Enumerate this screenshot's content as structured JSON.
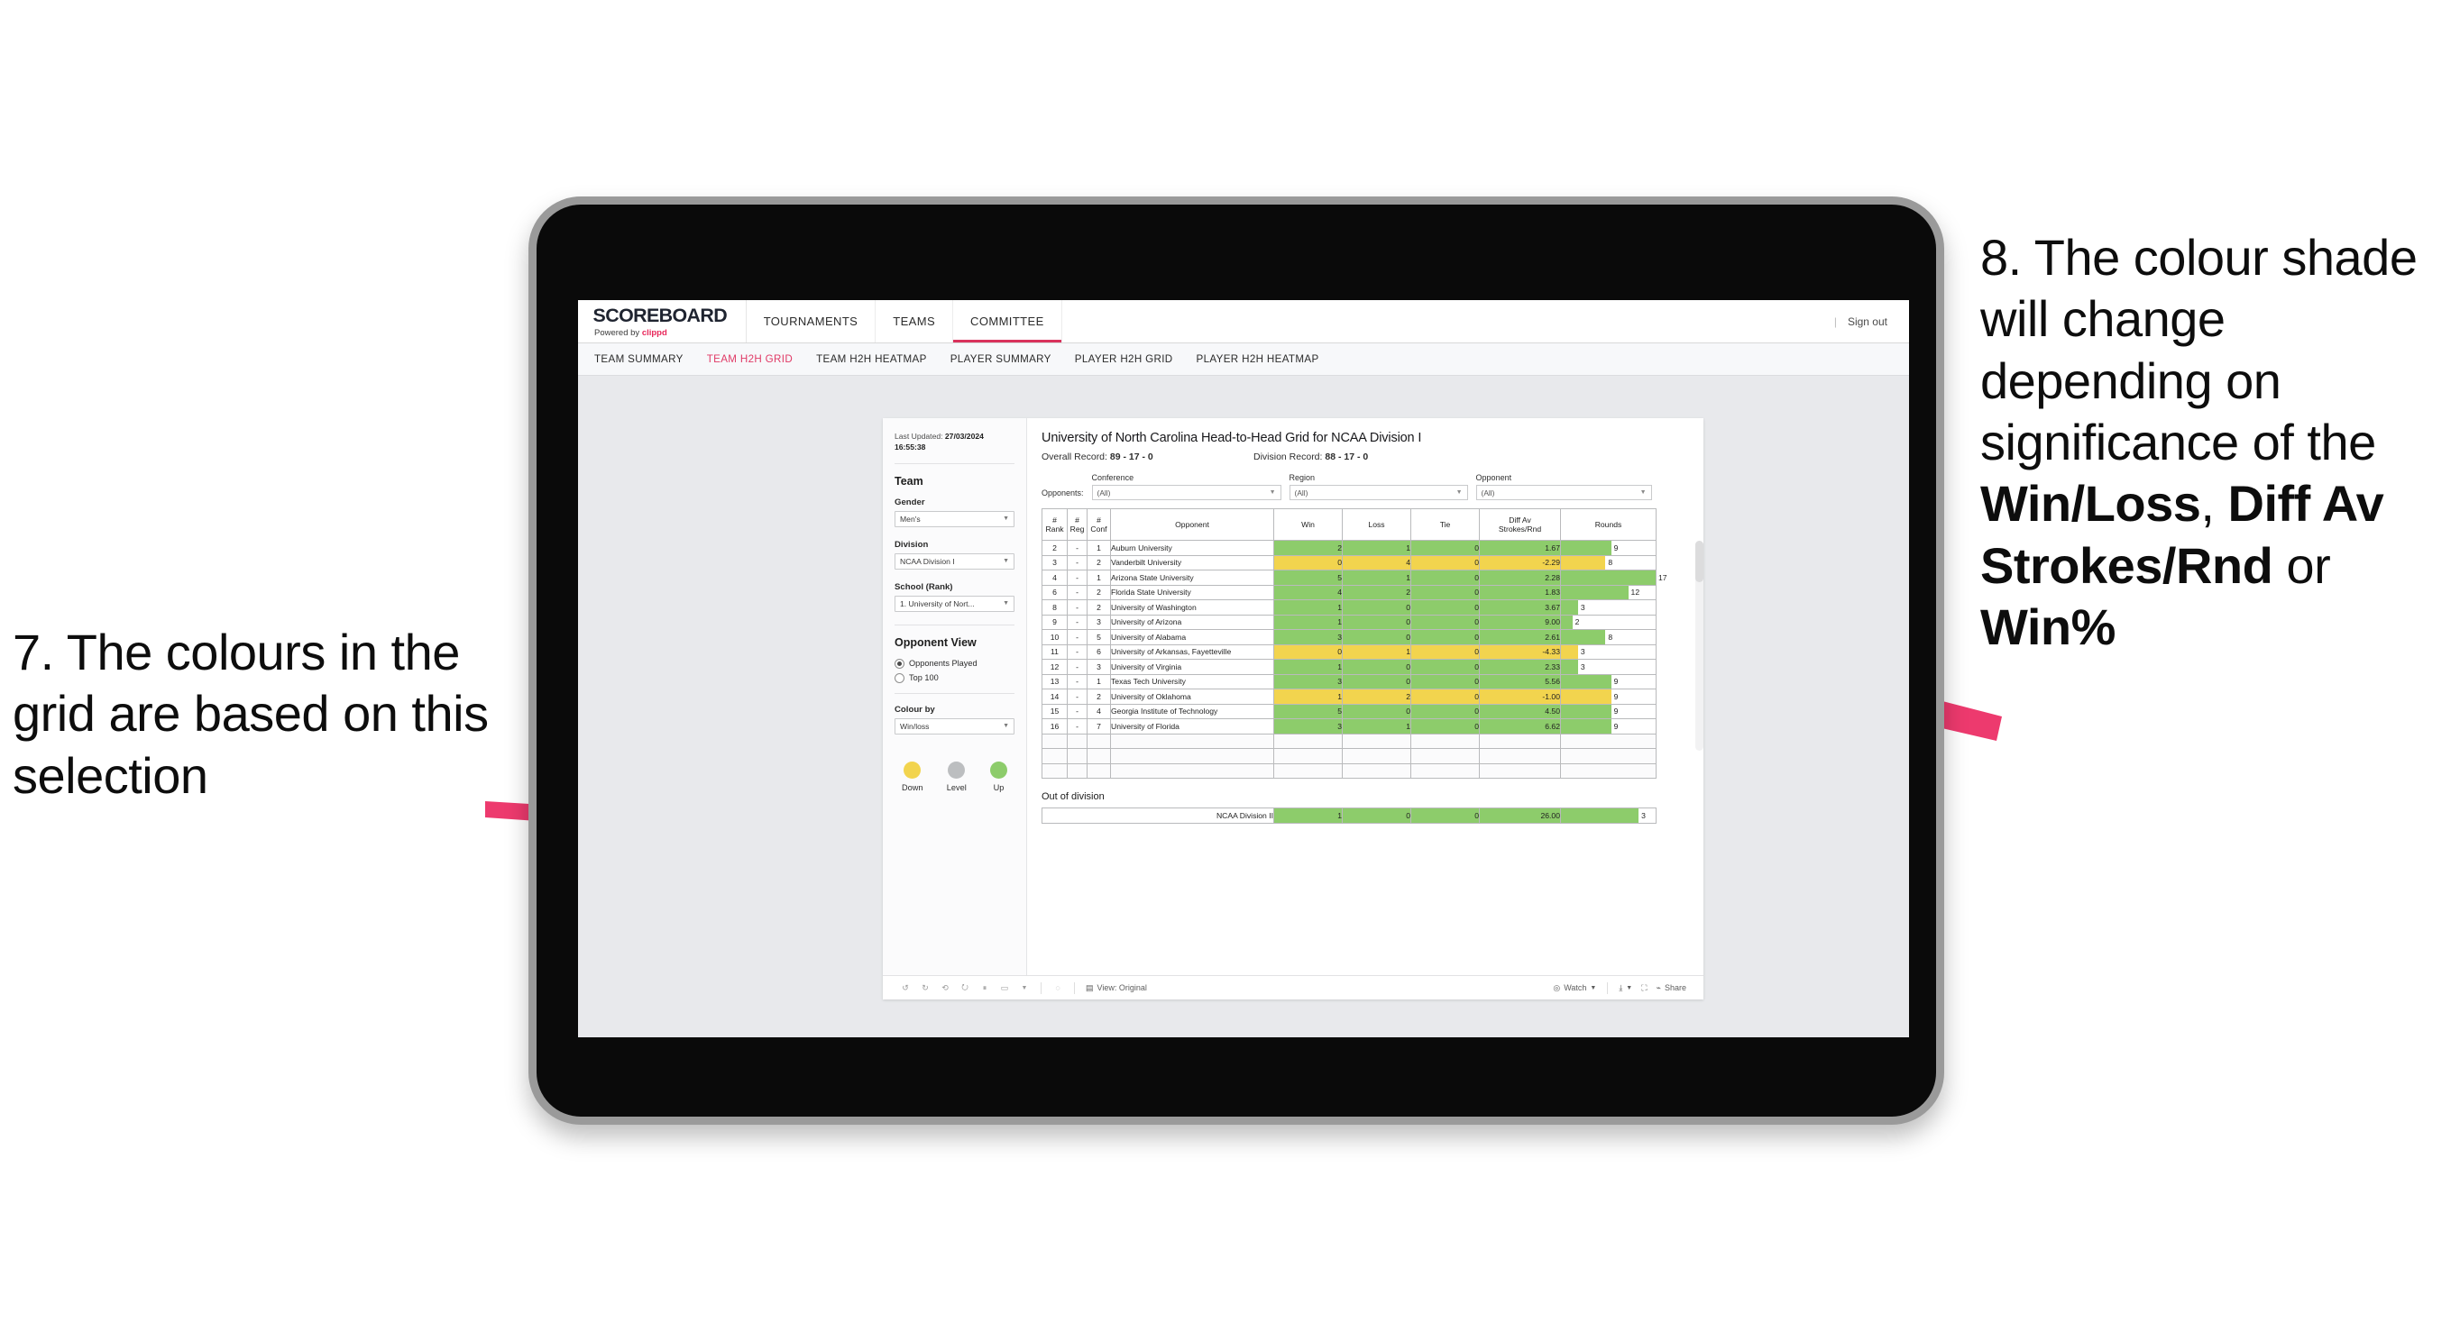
{
  "annotations": {
    "left": {
      "id": "7.",
      "text": "7. The colours in the grid are based on this selection"
    },
    "right": {
      "prefix": "8. The colour shade will change depending on significance of the ",
      "bold1": "Win/Loss",
      "mid1": ", ",
      "bold2": "Diff Av Strokes/Rnd",
      "mid2": " or ",
      "bold3": "Win%"
    },
    "arrow_color": "#ED3A6E"
  },
  "app": {
    "brand": {
      "title": "SCOREBOARD",
      "powered_prefix": "Powered by ",
      "powered_brand": "clippd"
    },
    "nav": [
      {
        "label": "TOURNAMENTS",
        "active": false
      },
      {
        "label": "TEAMS",
        "active": false
      },
      {
        "label": "COMMITTEE",
        "active": true
      }
    ],
    "signout": "Sign out",
    "signout_sep": "|",
    "subnav": [
      {
        "label": "TEAM SUMMARY",
        "active": false
      },
      {
        "label": "TEAM H2H GRID",
        "active": true
      },
      {
        "label": "TEAM H2H HEATMAP",
        "active": false
      },
      {
        "label": "PLAYER SUMMARY",
        "active": false
      },
      {
        "label": "PLAYER H2H GRID",
        "active": false
      },
      {
        "label": "PLAYER H2H HEATMAP",
        "active": false
      }
    ]
  },
  "panel": {
    "last_updated_label": "Last Updated: ",
    "last_updated_value": "27/03/2024 16:55:38",
    "team_title": "Team",
    "gender_label": "Gender",
    "gender_value": "Men's",
    "division_label": "Division",
    "division_value": "NCAA Division I",
    "school_label": "School (Rank)",
    "school_value": "1. University of Nort...",
    "opponent_view_title": "Opponent View",
    "opponent_view_options": [
      {
        "label": "Opponents Played",
        "selected": true
      },
      {
        "label": "Top 100",
        "selected": false
      }
    ],
    "colour_by_label": "Colour by",
    "colour_by_value": "Win/loss",
    "legend": [
      {
        "label": "Down",
        "color": "#F2D44E"
      },
      {
        "label": "Level",
        "color": "#BCBEC0"
      },
      {
        "label": "Up",
        "color": "#8DCC6B"
      }
    ]
  },
  "viz": {
    "title": "University of North Carolina Head-to-Head Grid for NCAA Division I",
    "overall_record_label": "Overall Record: ",
    "overall_record_value": "89 - 17 - 0",
    "division_record_label": "Division Record: ",
    "division_record_value": "88 - 17 - 0",
    "opponents_label": "Opponents:",
    "filters": [
      {
        "title": "Conference",
        "value": "(All)"
      },
      {
        "title": "Region",
        "value": "(All)"
      },
      {
        "title": "Opponent",
        "value": "(All)"
      }
    ],
    "out_of_division_title": "Out of division",
    "out_of_division_row": {
      "label": "NCAA Division II",
      "win": "1",
      "loss": "0",
      "tie": "0",
      "diff": "26.00",
      "rounds": "3",
      "color": "#8DCC6B",
      "rounds_pct": 82
    }
  },
  "chart_data": {
    "type": "table",
    "title": "University of North Carolina Head-to-Head Grid for NCAA Division I",
    "columns": [
      "# Rank",
      "# Reg",
      "# Conf",
      "Opponent",
      "Win",
      "Loss",
      "Tie",
      "Diff Av Strokes/Rnd",
      "Rounds"
    ],
    "column_header_lines": [
      [
        "#",
        "Rank"
      ],
      [
        "#",
        "Reg"
      ],
      [
        "#",
        "Conf"
      ],
      [
        "Opponent"
      ],
      [
        "Win"
      ],
      [
        "Loss"
      ],
      [
        "Tie"
      ],
      [
        "Diff Av",
        "Strokes/Rnd"
      ],
      [
        "Rounds"
      ]
    ],
    "colors": {
      "up": "#8DCC6B",
      "down": "#F2D44E",
      "level": "#BCBEC0"
    },
    "rounds_max": 17,
    "rows": [
      {
        "rank": "2",
        "reg": "-",
        "conf": "1",
        "opponent": "Auburn University",
        "win": "2",
        "loss": "1",
        "tie": "0",
        "diff": "1.67",
        "rounds": "9",
        "color": "#8DCC6B"
      },
      {
        "rank": "3",
        "reg": "-",
        "conf": "2",
        "opponent": "Vanderbilt University",
        "win": "0",
        "loss": "4",
        "tie": "0",
        "diff": "-2.29",
        "rounds": "8",
        "color": "#F2D44E"
      },
      {
        "rank": "4",
        "reg": "-",
        "conf": "1",
        "opponent": "Arizona State University",
        "win": "5",
        "loss": "1",
        "tie": "0",
        "diff": "2.28",
        "rounds": "17",
        "color": "#8DCC6B"
      },
      {
        "rank": "6",
        "reg": "-",
        "conf": "2",
        "opponent": "Florida State University",
        "win": "4",
        "loss": "2",
        "tie": "0",
        "diff": "1.83",
        "rounds": "12",
        "color": "#8DCC6B"
      },
      {
        "rank": "8",
        "reg": "-",
        "conf": "2",
        "opponent": "University of Washington",
        "win": "1",
        "loss": "0",
        "tie": "0",
        "diff": "3.67",
        "rounds": "3",
        "color": "#8DCC6B"
      },
      {
        "rank": "9",
        "reg": "-",
        "conf": "3",
        "opponent": "University of Arizona",
        "win": "1",
        "loss": "0",
        "tie": "0",
        "diff": "9.00",
        "rounds": "2",
        "color": "#8DCC6B"
      },
      {
        "rank": "10",
        "reg": "-",
        "conf": "5",
        "opponent": "University of Alabama",
        "win": "3",
        "loss": "0",
        "tie": "0",
        "diff": "2.61",
        "rounds": "8",
        "color": "#8DCC6B"
      },
      {
        "rank": "11",
        "reg": "-",
        "conf": "6",
        "opponent": "University of Arkansas, Fayetteville",
        "win": "0",
        "loss": "1",
        "tie": "0",
        "diff": "-4.33",
        "rounds": "3",
        "color": "#F2D44E"
      },
      {
        "rank": "12",
        "reg": "-",
        "conf": "3",
        "opponent": "University of Virginia",
        "win": "1",
        "loss": "0",
        "tie": "0",
        "diff": "2.33",
        "rounds": "3",
        "color": "#8DCC6B"
      },
      {
        "rank": "13",
        "reg": "-",
        "conf": "1",
        "opponent": "Texas Tech University",
        "win": "3",
        "loss": "0",
        "tie": "0",
        "diff": "5.56",
        "rounds": "9",
        "color": "#8DCC6B"
      },
      {
        "rank": "14",
        "reg": "-",
        "conf": "2",
        "opponent": "University of Oklahoma",
        "win": "1",
        "loss": "2",
        "tie": "0",
        "diff": "-1.00",
        "rounds": "9",
        "color": "#F2D44E"
      },
      {
        "rank": "15",
        "reg": "-",
        "conf": "4",
        "opponent": "Georgia Institute of Technology",
        "win": "5",
        "loss": "0",
        "tie": "0",
        "diff": "4.50",
        "rounds": "9",
        "color": "#8DCC6B"
      },
      {
        "rank": "16",
        "reg": "-",
        "conf": "7",
        "opponent": "University of Florida",
        "win": "3",
        "loss": "1",
        "tie": "0",
        "diff": "6.62",
        "rounds": "9",
        "color": "#8DCC6B"
      }
    ]
  },
  "toolbar": {
    "view_label": "View: Original",
    "watch_label": "Watch",
    "share_label": "Share"
  }
}
